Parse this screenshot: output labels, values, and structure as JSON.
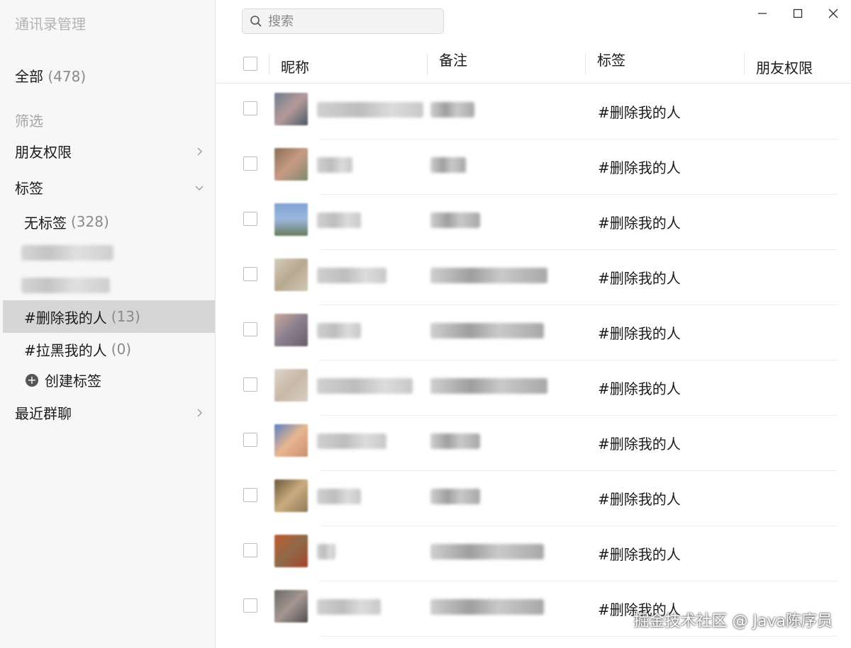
{
  "sidebar": {
    "title": "通讯录管理",
    "all_label": "全部",
    "all_count": "(478)",
    "filter_label": "筛选",
    "friend_perm": "朋友权限",
    "tags_label": "标签",
    "tags": [
      {
        "label": "无标签",
        "count": "(328)"
      },
      {
        "label": "#删除我的人",
        "count": "(13)"
      },
      {
        "label": "#拉黑我的人",
        "count": "(0)"
      }
    ],
    "create_tag": "创建标签",
    "recent_groups": "最近群聊"
  },
  "search": {
    "placeholder": "搜索"
  },
  "table": {
    "headers": {
      "nickname": "昵称",
      "remark": "备注",
      "tag": "标签",
      "permission": "朋友权限"
    },
    "rows": [
      {
        "tag": "#删除我的人"
      },
      {
        "tag": "#删除我的人"
      },
      {
        "tag": "#删除我的人"
      },
      {
        "tag": "#删除我的人"
      },
      {
        "tag": "#删除我的人"
      },
      {
        "tag": "#删除我的人"
      },
      {
        "tag": "#删除我的人"
      },
      {
        "tag": "#删除我的人"
      },
      {
        "tag": "#删除我的人"
      },
      {
        "tag": "#删除我的人"
      }
    ]
  },
  "watermark": "掘金技术社区 @ Java陈序员"
}
